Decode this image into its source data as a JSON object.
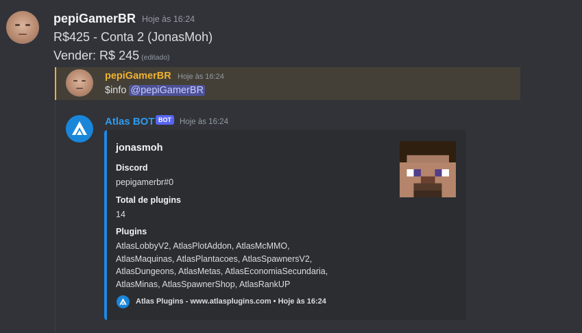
{
  "message": {
    "author": "pepiGamerBR",
    "timestamp": "Hoje às 16:24",
    "line1": "R$425 - Conta 2 (JonasMoh)",
    "line2": "Vender: R$ 245",
    "edited": "(editado)"
  },
  "reply": {
    "author": "pepiGamerBR",
    "timestamp": "Hoje às 16:24",
    "command": "$info",
    "mention": "@pepiGamerBR",
    "highlight_color": "#f0b232"
  },
  "bot": {
    "name": "Atlas BOT",
    "badge": "BOT",
    "timestamp": "Hoje às 16:24",
    "name_color": "#2d9cf0"
  },
  "embed": {
    "accent_color": "#1e88e5",
    "title": "jonasmoh",
    "fields": [
      {
        "name": "Discord",
        "value": "pepigamerbr#0"
      },
      {
        "name": "Total de plugins",
        "value": "14"
      },
      {
        "name": "Plugins",
        "lines": [
          "AtlasLobbyV2, AtlasPlotAddon, AtlasMcMMO,",
          "AtlasMaquinas, AtlasPlantacoes, AtlasSpawnersV2,",
          "AtlasDungeons, AtlasMetas, AtlasEconomiaSecundaria,",
          "AtlasMinas, AtlasSpawnerShop, AtlasRankUP"
        ]
      }
    ],
    "thumbnail": "minecraft-steve-head",
    "footer": "Atlas Plugins - www.atlasplugins.com • Hoje às 16:24"
  }
}
